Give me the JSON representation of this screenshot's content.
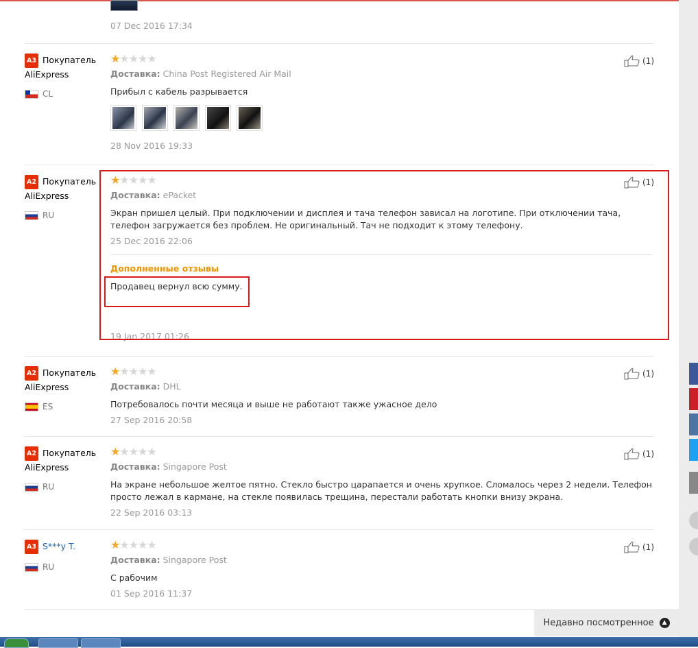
{
  "like_icon": "thumb-up-icon",
  "reviews": [
    {
      "id": "r0",
      "date": "07 Dec 2016 17:34"
    },
    {
      "id": "r1",
      "level": "A3",
      "buyer": "Покупатель",
      "buyer2": "AliExpress",
      "country": "CL",
      "rating": 1,
      "shipping_label": "Доставка:",
      "shipping": "China Post Registered Air Mail",
      "text": "Прибыл с кабель разрывается",
      "date": "28 Nov 2016 19:33",
      "likes": "(1)",
      "photos": 5
    },
    {
      "id": "r2",
      "level": "A2",
      "buyer": "Покупатель",
      "buyer2": "AliExpress",
      "country": "RU",
      "rating": 1,
      "shipping_label": "Доставка:",
      "shipping": "ePacket",
      "text": "Экран пришел целый. При подключении и дисплея и тача телефон зависал на логотипе. При отключении тача, телефон загружается без проблем. Не оригинальный. Тач не подходит к этому телефону.",
      "date": "25 Dec 2016 22:06",
      "likes": "(1)",
      "additional_title": "Дополненные отзывы",
      "additional_text": "Продавец вернул всю сумму.",
      "additional_date": "19 Jan 2017 01:26"
    },
    {
      "id": "r3",
      "level": "A2",
      "buyer": "Покупатель",
      "buyer2": "AliExpress",
      "country": "ES",
      "rating": 1,
      "shipping_label": "Доставка:",
      "shipping": "DHL",
      "text": "Потребовалось почти месяца и выше не работают также ужасное дело",
      "date": "27 Sep 2016 20:58",
      "likes": "(1)"
    },
    {
      "id": "r4",
      "level": "A2",
      "buyer": "Покупатель",
      "buyer2": "AliExpress",
      "country": "RU",
      "rating": 1,
      "shipping_label": "Доставка:",
      "shipping": "Singapore Post",
      "text": "На экране небольшое желтое пятно. Стекло быстро царапается и очень хрупкое. Сломалось через 2 недели. Телефон просто лежал в кармане, на стекле появилась трещина, перестали работать кнопки внизу экрана.",
      "date": "22 Sep 2016 03:13",
      "likes": "(1)"
    },
    {
      "id": "r5",
      "level": "A3",
      "buyer": "S***y T.",
      "country": "RU",
      "rating": 1,
      "shipping_label": "Доставка:",
      "shipping": "Singapore Post",
      "text": "С рабочим",
      "date": "01 Sep 2016 11:37",
      "likes": "(1)"
    }
  ],
  "recently_viewed": "Недавно посмотренное",
  "social": [
    "facebook-icon",
    "pinterest-icon",
    "vk-icon",
    "twitter-icon",
    "more-icon"
  ],
  "colors": {
    "accent": "#f29600",
    "star": "#f5a623",
    "level_badge": "#e62e04",
    "highlight_box": "#d7191c"
  }
}
